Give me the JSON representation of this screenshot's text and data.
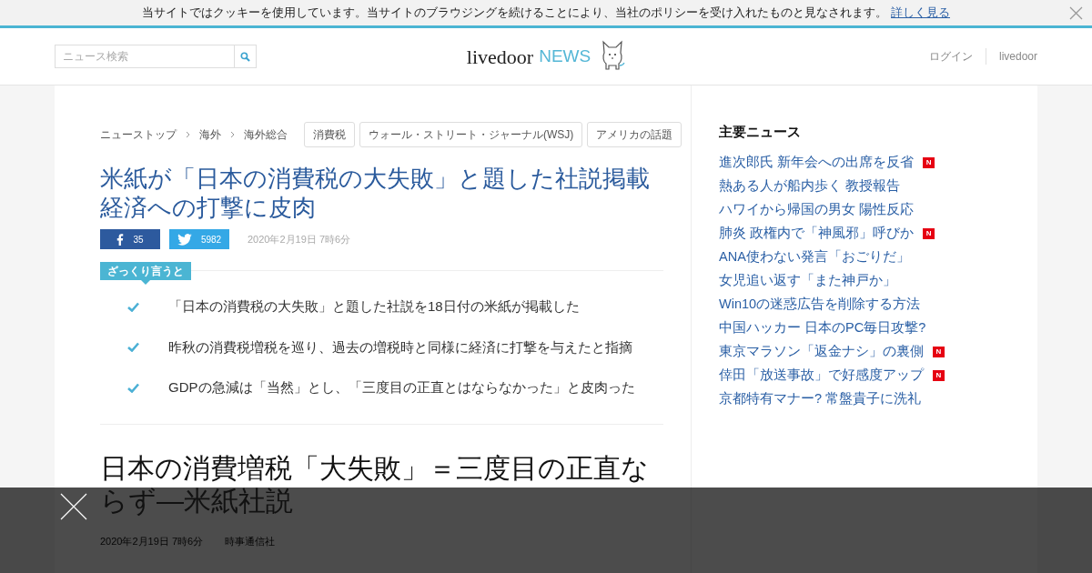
{
  "cookie_banner": {
    "text": "当サイトではクッキーを使用しています。当サイトのブラウジングを続けることにより、当社のポリシーを受け入れたものと見なされます。",
    "link": "詳しく見る"
  },
  "header": {
    "search": {
      "placeholder": "ニュース検索"
    },
    "logo": {
      "brand": "livedoor",
      "product": "NEWS"
    },
    "nav": [
      "ログイン",
      "livedoor"
    ]
  },
  "article": {
    "breadcrumbs": [
      "ニューストップ",
      "海外",
      "海外総合"
    ],
    "tags": [
      "消費税",
      "ウォール・ストリート・ジャーナル(WSJ)",
      "アメリカの話題"
    ],
    "title": "米紙が「日本の消費税の大失敗」と題した社説掲載経済への打撃に皮肉",
    "share": [
      {
        "kind": "facebook",
        "count": "35"
      },
      {
        "kind": "twitter",
        "count": "5982"
      }
    ],
    "date": "2020年2月19日 7時6分",
    "summary": {
      "label": "ざっくり言うと",
      "items": [
        "「日本の消費税の大失敗」と題した社説を18日付の米紙が掲載した",
        "昨秋の消費税増税を巡り、過去の増税時と同様に経済に打撃を与えたと指摘",
        "GDPの急減は「当然」とし、「三度目の正直とはならなかった」と皮肉った"
      ]
    },
    "body_title": "日本の消費増税「大失敗」＝三度目の正直ならず―米紙社説",
    "body_date": "2020年2月19日 7時6分",
    "source": "時事通信社"
  },
  "sidebar": {
    "heading": "主要ニュース",
    "items": [
      {
        "title": "進次郎氏 新年会への出席を反省",
        "new": true,
        "badge": "N"
      },
      {
        "title": "熱ある人が船内歩く 教授報告",
        "new": false
      },
      {
        "title": "ハワイから帰国の男女 陽性反応",
        "new": false
      },
      {
        "title": "肺炎 政権内で「神風邪」呼びか",
        "new": true,
        "badge": "N"
      },
      {
        "title": "ANA使わない発言「おごりだ」",
        "new": false
      },
      {
        "title": "女児追い返す「また神戸か」",
        "new": false
      },
      {
        "title": "Win10の迷惑広告を削除する方法",
        "new": false
      },
      {
        "title": "中国ハッカー 日本のPC毎日攻撃?",
        "new": false
      },
      {
        "title": "東京マラソン「返金ナシ」の裏側",
        "new": true,
        "badge": "N"
      },
      {
        "title": "倖田「放送事故」で好感度アップ",
        "new": true,
        "badge": "N"
      },
      {
        "title": "京都特有マナー? 常盤貴子に洗礼",
        "new": false
      }
    ]
  }
}
